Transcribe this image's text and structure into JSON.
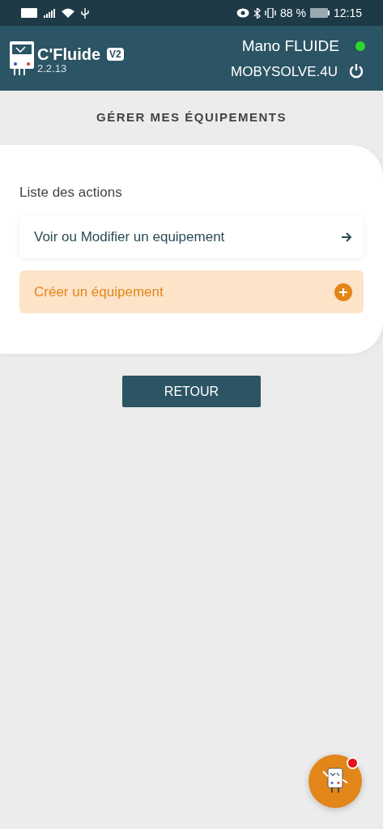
{
  "status_bar": {
    "battery_percent": "88 %",
    "time": "12:15"
  },
  "header": {
    "app_name": "C'Fluide",
    "badge": "V2",
    "version": "2.2.13",
    "device": "Mano FLUIDE",
    "connected": true,
    "account": "MOBYSOLVE.4U"
  },
  "page_title": "GÉRER MES ÉQUIPEMENTS",
  "actions": {
    "heading": "Liste des actions",
    "items": [
      {
        "kind": "link",
        "label": "Voir ou Modifier un equipement"
      },
      {
        "kind": "create",
        "label": "Créer un équipement"
      }
    ]
  },
  "back_button": "RETOUR",
  "assistant": {
    "unread": true
  }
}
